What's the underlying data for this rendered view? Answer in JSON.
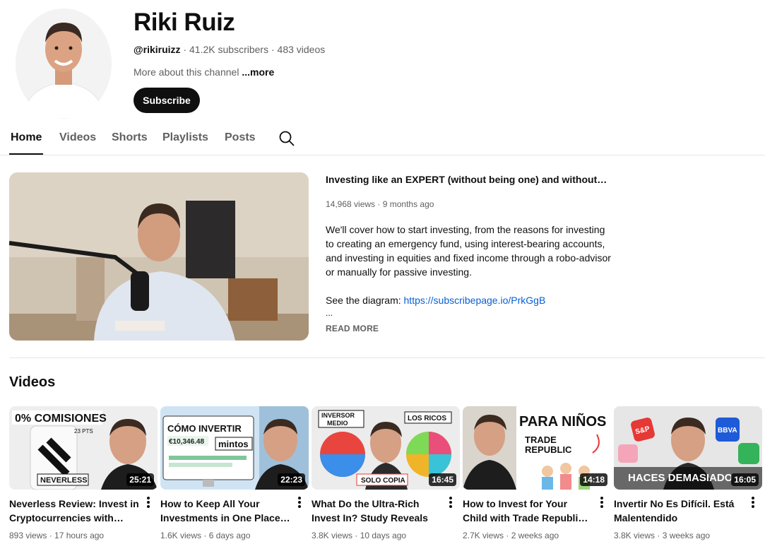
{
  "channel": {
    "name": "Riki Ruiz",
    "handle": "@rikiruizz",
    "subscribers": "41.2K subscribers",
    "video_count": "483 videos",
    "separator": " · ",
    "about": "More about this channel",
    "about_more": " ...more",
    "subscribe_label": "Subscribe",
    "avatar_icon": "avatar-photo"
  },
  "tabs": [
    {
      "label": "Home",
      "active": true
    },
    {
      "label": "Videos",
      "active": false
    },
    {
      "label": "Shorts",
      "active": false
    },
    {
      "label": "Playlists",
      "active": false
    },
    {
      "label": "Posts",
      "active": false
    }
  ],
  "search_icon": "search-icon",
  "featured": {
    "title": "Investing like an EXPERT (without being one) and without dedi...",
    "views": "14,968 views",
    "age": "9 months ago",
    "description": "We'll cover how to start investing, from the reasons for investing to creating an emergency fund, using interest-bearing accounts, and investing in equities and fixed income through a robo-advisor or manually for passive investing.",
    "diagram_label": "See the diagram: ",
    "diagram_link": "https://subscribepage.io/PrkGgB",
    "ellipsis": "...",
    "read_more": "READ MORE"
  },
  "shelf": {
    "title": "Videos",
    "videos": [
      {
        "title": "Neverless Review: Invest in Cryptocurrencies with NO...",
        "views": "893 views",
        "age": "17 hours ago",
        "duration": "25:21",
        "thumb_text_1": "0% COMISIONES",
        "thumb_text_2": "NEVERLESS",
        "thumb_text_3": "23 PTS"
      },
      {
        "title": "How to Keep All Your Investments in One Place |...",
        "views": "1.6K views",
        "age": "6 days ago",
        "duration": "22:23",
        "thumb_text_1": "CÓMO INVERTIR",
        "thumb_text_2": "mintos",
        "thumb_text_3": "€10,346.48"
      },
      {
        "title": "What Do the Ultra-Rich Invest In? Study Reveals",
        "views": "3.8K views",
        "age": "10 days ago",
        "duration": "16:45",
        "thumb_text_1": "INVERSOR",
        "thumb_text_2": "MEDIO",
        "thumb_text_3": "LOS RICOS",
        "thumb_text_4": "SOLO COPIA"
      },
      {
        "title": "How to Invest for Your Child with Trade Republic | Step-...",
        "views": "2.7K views",
        "age": "2 weeks ago",
        "duration": "14:18",
        "thumb_text_1": "PARA NIÑOS",
        "thumb_text_2": "TRADE",
        "thumb_text_3": "REPUBLIC"
      },
      {
        "title": "Invertir No Es Difícil. Está Malentendido",
        "views": "3.8K views",
        "age": "3 weeks ago",
        "duration": "16:05",
        "thumb_text_1": "HACES DEMASIADO",
        "thumb_text_2": "S&P",
        "thumb_text_3": "BBVA"
      }
    ]
  },
  "menu_icon": "more-vert-icon"
}
